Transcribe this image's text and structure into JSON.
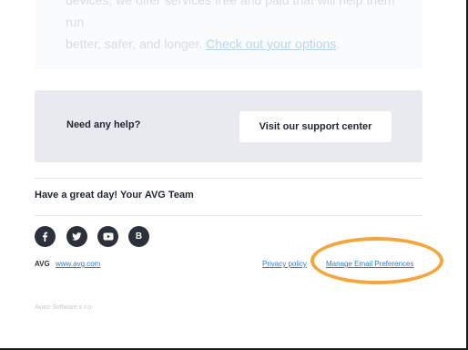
{
  "intro": {
    "line1": "devices, we offer services free and paid that will help them run",
    "line2_prefix": "better, safer, and longer. ",
    "link": "Check out your options",
    "line2_suffix": "."
  },
  "help": {
    "label": "Need any help?",
    "button": "Visit our support center"
  },
  "signoff": "Have a great day! Your AVG Team",
  "social": [
    {
      "icon": "facebook-icon",
      "glyph": "f"
    },
    {
      "icon": "twitter-icon",
      "glyph": "bird"
    },
    {
      "icon": "youtube-icon",
      "glyph": "play"
    },
    {
      "icon": "blog-icon",
      "glyph": "B"
    }
  ],
  "footer": {
    "brand": "AVG",
    "site": "www.avg.com",
    "privacy": "Privacy policy",
    "prefs": "Manage Email Preferences",
    "company": "Avast Software s.r.o."
  },
  "colors": {
    "highlight": "#f4a63c",
    "link": "#2f7fd1",
    "dark": "#1f2530"
  }
}
